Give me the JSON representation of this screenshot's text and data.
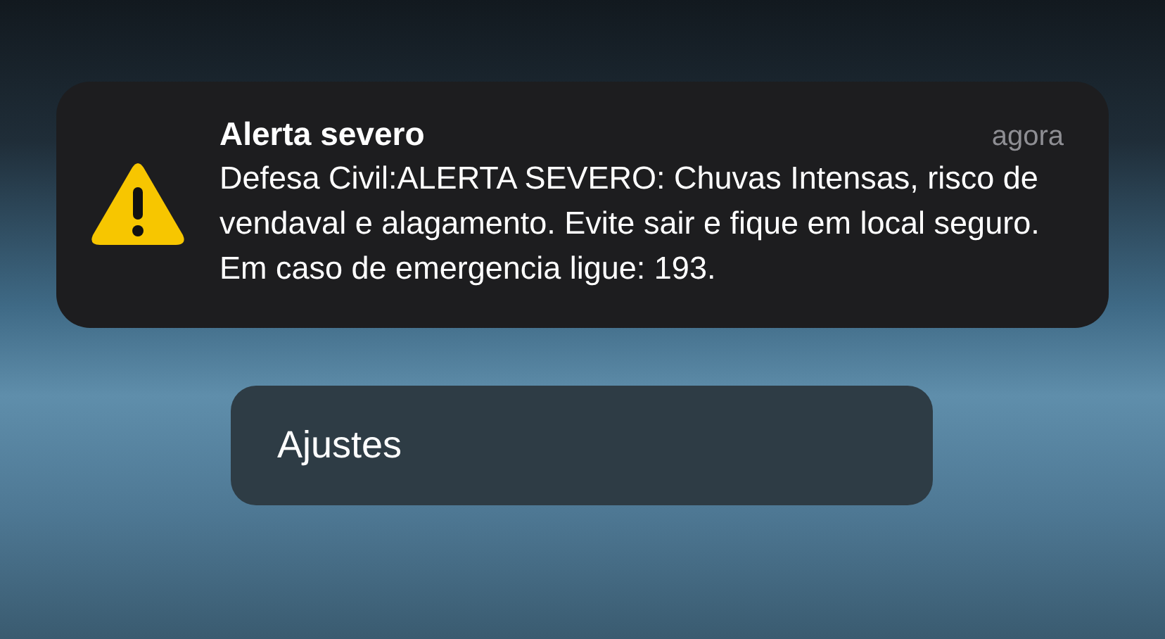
{
  "notification": {
    "title": "Alerta severo",
    "time": "agora",
    "body": "Defesa Civil:ALERTA SEVERO: Chuvas Intensas, risco de vendaval e alagamento. Evite sair e fique em local seguro. Em caso de emergencia ligue: 193."
  },
  "buttons": [
    {
      "label": "Ajustes"
    }
  ]
}
